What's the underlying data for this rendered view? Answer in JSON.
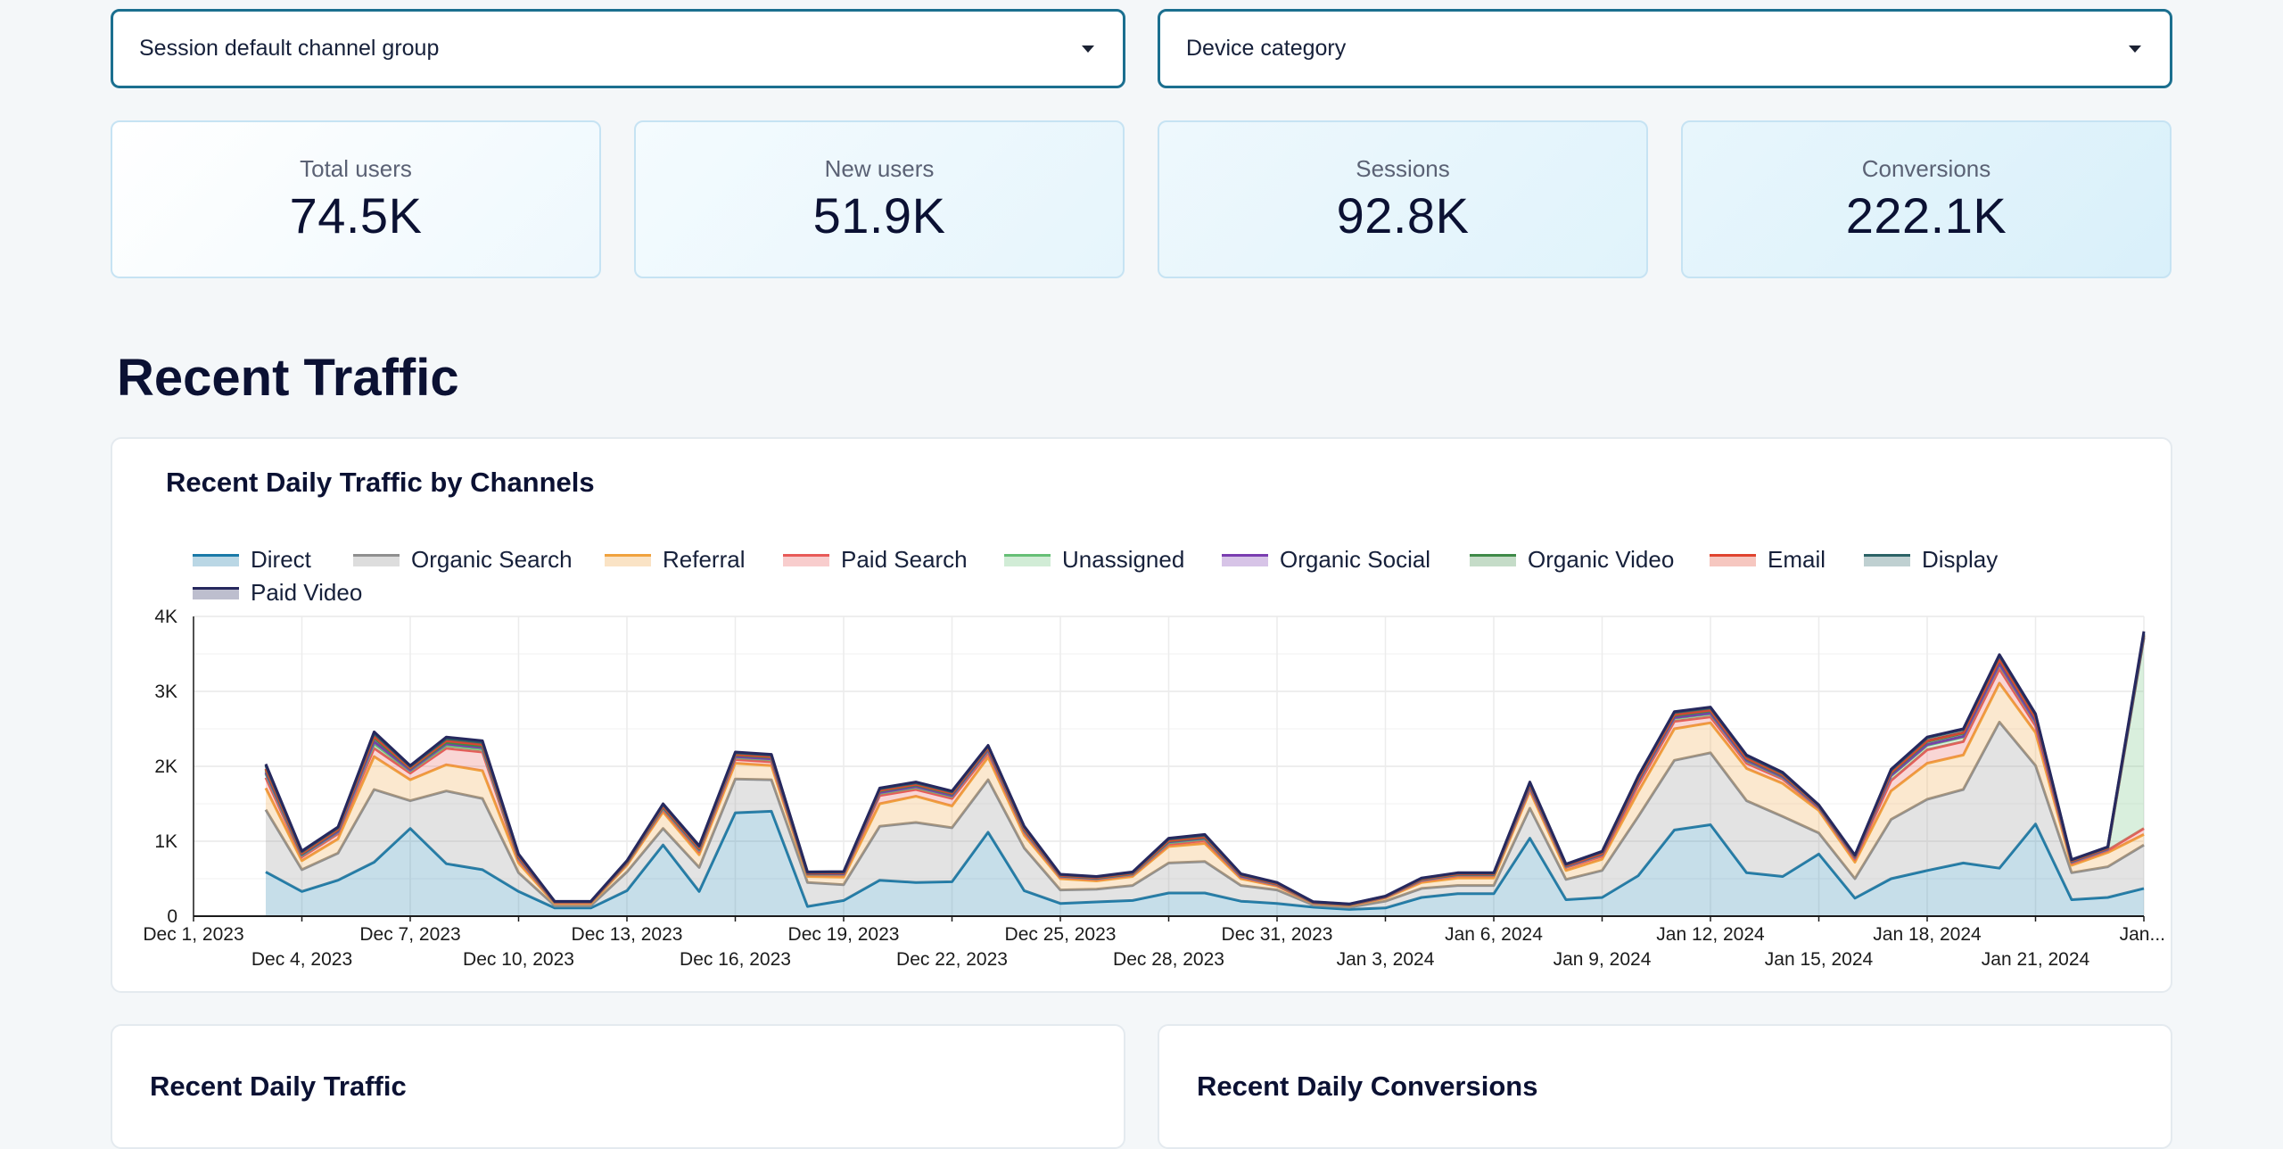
{
  "filters": {
    "channel_group_label": "Session default channel group",
    "device_category_label": "Device category"
  },
  "kpis": [
    {
      "label": "Total users",
      "value": "74.5K"
    },
    {
      "label": "New users",
      "value": "51.9K"
    },
    {
      "label": "Sessions",
      "value": "92.8K"
    },
    {
      "label": "Conversions",
      "value": "222.1K"
    }
  ],
  "section_title": "Recent Traffic",
  "main_chart_title": "Recent Daily Traffic by Channels",
  "bottom_left_title": "Recent Daily Traffic",
  "bottom_right_title": "Recent Daily Conversions",
  "chart_data": {
    "type": "area",
    "stacked": true,
    "title": "Recent Daily Traffic by Channels",
    "xlabel": "",
    "ylabel": "",
    "ylim": [
      0,
      4000
    ],
    "yticks": [
      {
        "value": 0,
        "label": "0"
      },
      {
        "value": 1000,
        "label": "1K"
      },
      {
        "value": 2000,
        "label": "2K"
      },
      {
        "value": 3000,
        "label": "3K"
      },
      {
        "value": 4000,
        "label": "4K"
      }
    ],
    "grid": true,
    "legend_position": "top-left",
    "x": [
      "Dec 1, 2023",
      "Dec 2, 2023",
      "Dec 3, 2023",
      "Dec 4, 2023",
      "Dec 5, 2023",
      "Dec 6, 2023",
      "Dec 7, 2023",
      "Dec 8, 2023",
      "Dec 9, 2023",
      "Dec 10, 2023",
      "Dec 11, 2023",
      "Dec 12, 2023",
      "Dec 13, 2023",
      "Dec 14, 2023",
      "Dec 15, 2023",
      "Dec 16, 2023",
      "Dec 17, 2023",
      "Dec 18, 2023",
      "Dec 19, 2023",
      "Dec 20, 2023",
      "Dec 21, 2023",
      "Dec 22, 2023",
      "Dec 23, 2023",
      "Dec 24, 2023",
      "Dec 25, 2023",
      "Dec 26, 2023",
      "Dec 27, 2023",
      "Dec 28, 2023",
      "Dec 29, 2023",
      "Dec 30, 2023",
      "Dec 31, 2023",
      "Jan 1, 2024",
      "Jan 2, 2024",
      "Jan 3, 2024",
      "Jan 4, 2024",
      "Jan 5, 2024",
      "Jan 6, 2024",
      "Jan 7, 2024",
      "Jan 8, 2024",
      "Jan 9, 2024",
      "Jan 10, 2024",
      "Jan 11, 2024",
      "Jan 12, 2024",
      "Jan 13, 2024",
      "Jan 14, 2024",
      "Jan 15, 2024",
      "Jan 16, 2024",
      "Jan 17, 2024",
      "Jan 18, 2024",
      "Jan 19, 2024",
      "Jan 20, 2024",
      "Jan 21, 2024",
      "Jan 22, 2024",
      "Jan 23, 2024",
      "Jan 24, 2024"
    ],
    "first_point_index": 2,
    "xticks": [
      {
        "index": 0,
        "label": "Dec 1, 2023",
        "row": 0
      },
      {
        "index": 3,
        "label": "Dec 4, 2023",
        "row": 1
      },
      {
        "index": 6,
        "label": "Dec 7, 2023",
        "row": 0
      },
      {
        "index": 9,
        "label": "Dec 10, 2023",
        "row": 1
      },
      {
        "index": 12,
        "label": "Dec 13, 2023",
        "row": 0
      },
      {
        "index": 15,
        "label": "Dec 16, 2023",
        "row": 1
      },
      {
        "index": 18,
        "label": "Dec 19, 2023",
        "row": 0
      },
      {
        "index": 21,
        "label": "Dec 22, 2023",
        "row": 1
      },
      {
        "index": 24,
        "label": "Dec 25, 2023",
        "row": 0
      },
      {
        "index": 27,
        "label": "Dec 28, 2023",
        "row": 1
      },
      {
        "index": 30,
        "label": "Dec 31, 2023",
        "row": 0
      },
      {
        "index": 33,
        "label": "Jan 3, 2024",
        "row": 1
      },
      {
        "index": 36,
        "label": "Jan 6, 2024",
        "row": 0
      },
      {
        "index": 39,
        "label": "Jan 9, 2024",
        "row": 1
      },
      {
        "index": 42,
        "label": "Jan 12, 2024",
        "row": 0
      },
      {
        "index": 45,
        "label": "Jan 15, 2024",
        "row": 1
      },
      {
        "index": 48,
        "label": "Jan 18, 2024",
        "row": 0
      },
      {
        "index": 51,
        "label": "Jan 21, 2024",
        "row": 1
      },
      {
        "index": 54,
        "label": "Jan...",
        "row": 0
      }
    ],
    "series": [
      {
        "name": "Direct",
        "color": "#1a7aa8",
        "values": [
          null,
          null,
          590,
          330,
          480,
          720,
          1170,
          700,
          620,
          330,
          110,
          110,
          340,
          950,
          330,
          1380,
          1400,
          130,
          210,
          480,
          450,
          460,
          1120,
          340,
          170,
          190,
          210,
          310,
          310,
          200,
          170,
          120,
          90,
          110,
          250,
          300,
          300,
          1040,
          220,
          250,
          540,
          1150,
          1220,
          580,
          530,
          830,
          240,
          500,
          610,
          710,
          640,
          1230,
          220,
          250,
          370
        ]
      },
      {
        "name": "Organic Search",
        "color": "#8f8f8f",
        "values": [
          null,
          null,
          830,
          290,
          360,
          970,
          370,
          970,
          950,
          250,
          30,
          30,
          250,
          220,
          320,
          450,
          420,
          320,
          210,
          720,
          800,
          720,
          700,
          570,
          180,
          170,
          200,
          400,
          420,
          210,
          180,
          30,
          30,
          90,
          120,
          110,
          110,
          400,
          270,
          360,
          790,
          930,
          960,
          960,
          800,
          280,
          260,
          790,
          950,
          980,
          1950,
          780,
          360,
          410,
          580
        ]
      },
      {
        "name": "Referral",
        "color": "#f0a23e",
        "values": [
          null,
          null,
          290,
          120,
          190,
          440,
          280,
          350,
          370,
          130,
          30,
          30,
          90,
          220,
          170,
          210,
          190,
          80,
          100,
          300,
          350,
          290,
          300,
          170,
          150,
          110,
          120,
          220,
          240,
          90,
          50,
          20,
          20,
          40,
          80,
          100,
          100,
          230,
          120,
          150,
          330,
          420,
          400,
          430,
          440,
          300,
          220,
          380,
          480,
          460,
          520,
          440,
          100,
          190,
          140
        ]
      },
      {
        "name": "Paid Search",
        "color": "#e85a58",
        "values": [
          null,
          null,
          140,
          50,
          70,
          110,
          90,
          220,
          250,
          40,
          10,
          10,
          20,
          30,
          40,
          50,
          50,
          20,
          30,
          110,
          90,
          100,
          60,
          40,
          20,
          20,
          20,
          30,
          40,
          20,
          10,
          5,
          5,
          10,
          20,
          30,
          30,
          30,
          40,
          40,
          90,
          100,
          80,
          70,
          60,
          30,
          40,
          140,
          180,
          180,
          190,
          90,
          30,
          30,
          80
        ]
      },
      {
        "name": "Unassigned",
        "color": "#66bf76",
        "values": [
          null,
          null,
          50,
          20,
          20,
          60,
          30,
          40,
          40,
          20,
          5,
          5,
          10,
          20,
          20,
          30,
          30,
          10,
          10,
          30,
          30,
          30,
          30,
          20,
          10,
          10,
          10,
          20,
          20,
          10,
          10,
          5,
          5,
          5,
          10,
          10,
          10,
          20,
          10,
          20,
          40,
          40,
          40,
          30,
          20,
          10,
          20,
          60,
          60,
          60,
          60,
          50,
          10,
          10,
          2540
        ]
      },
      {
        "name": "Organic Social",
        "color": "#7a3db0",
        "values": [
          null,
          null,
          20,
          10,
          10,
          30,
          10,
          20,
          20,
          10,
          2,
          2,
          5,
          10,
          10,
          10,
          10,
          5,
          5,
          10,
          10,
          10,
          10,
          10,
          5,
          5,
          5,
          10,
          10,
          5,
          5,
          2,
          2,
          2,
          5,
          5,
          5,
          10,
          5,
          5,
          10,
          10,
          10,
          10,
          10,
          5,
          5,
          10,
          10,
          10,
          10,
          10,
          5,
          5,
          10
        ]
      },
      {
        "name": "Organic Video",
        "color": "#3f8a48",
        "values": [
          null,
          null,
          30,
          10,
          20,
          50,
          20,
          20,
          20,
          10,
          2,
          2,
          5,
          10,
          10,
          20,
          20,
          5,
          10,
          20,
          20,
          20,
          20,
          10,
          5,
          5,
          5,
          10,
          10,
          10,
          5,
          2,
          2,
          2,
          5,
          5,
          5,
          20,
          10,
          10,
          20,
          30,
          30,
          20,
          20,
          10,
          10,
          30,
          40,
          40,
          50,
          40,
          10,
          10,
          20
        ]
      },
      {
        "name": "Email",
        "color": "#e0442f",
        "values": [
          null,
          null,
          20,
          10,
          10,
          20,
          10,
          20,
          20,
          10,
          2,
          2,
          5,
          10,
          10,
          10,
          10,
          5,
          5,
          10,
          10,
          10,
          10,
          10,
          5,
          5,
          5,
          10,
          10,
          5,
          5,
          2,
          2,
          2,
          5,
          5,
          5,
          10,
          5,
          5,
          10,
          10,
          10,
          10,
          10,
          5,
          5,
          10,
          10,
          10,
          10,
          10,
          5,
          5,
          10
        ]
      },
      {
        "name": "Display",
        "color": "#2c6366",
        "values": [
          null,
          null,
          40,
          20,
          20,
          40,
          20,
          30,
          30,
          20,
          5,
          5,
          10,
          20,
          20,
          20,
          20,
          10,
          10,
          20,
          20,
          20,
          20,
          20,
          10,
          10,
          10,
          20,
          20,
          10,
          10,
          5,
          5,
          5,
          10,
          10,
          10,
          20,
          10,
          20,
          30,
          30,
          30,
          30,
          20,
          10,
          10,
          30,
          40,
          40,
          50,
          40,
          10,
          10,
          20
        ]
      },
      {
        "name": "Paid Video",
        "color": "#26285e",
        "values": [
          null,
          null,
          20,
          10,
          10,
          20,
          10,
          20,
          20,
          10,
          2,
          2,
          5,
          10,
          10,
          10,
          10,
          5,
          5,
          10,
          10,
          10,
          10,
          10,
          5,
          5,
          5,
          10,
          10,
          5,
          5,
          2,
          2,
          2,
          5,
          5,
          5,
          10,
          5,
          5,
          10,
          10,
          10,
          10,
          10,
          5,
          5,
          10,
          10,
          10,
          10,
          10,
          5,
          5,
          30
        ]
      }
    ]
  }
}
